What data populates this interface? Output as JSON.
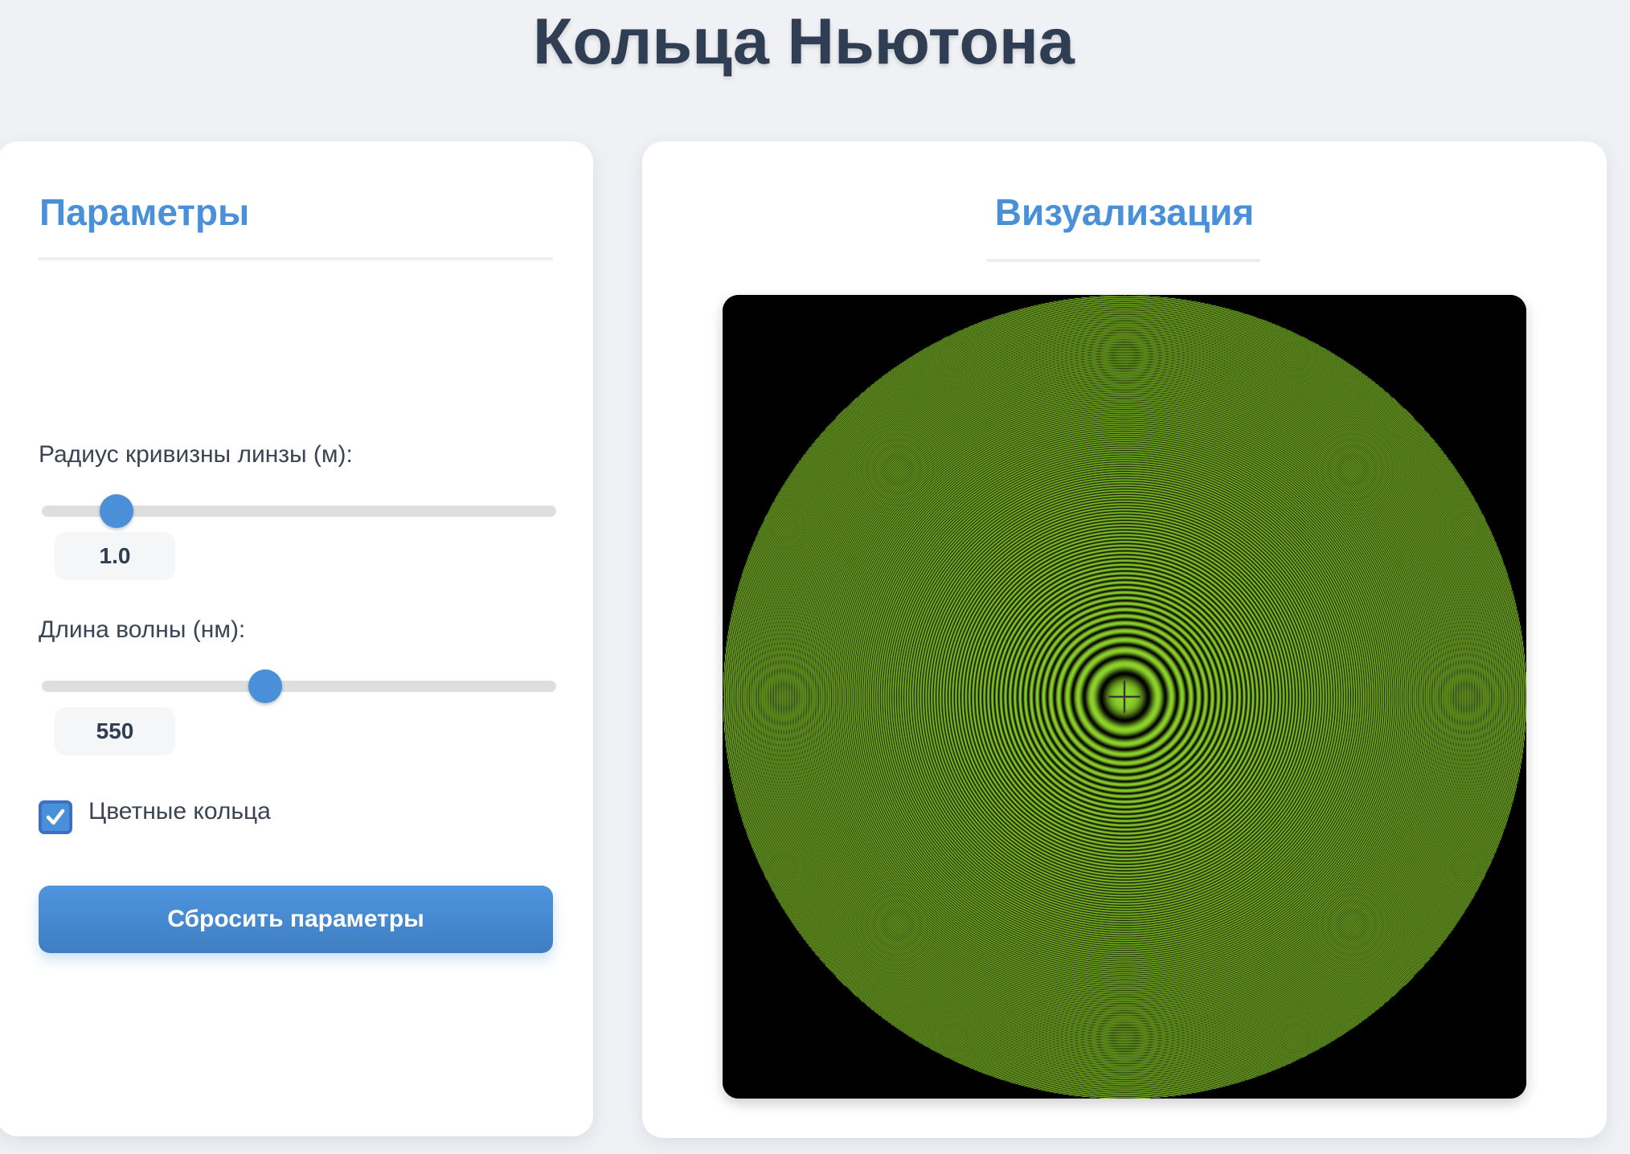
{
  "page": {
    "title": "Кольца Ньютона"
  },
  "params": {
    "title": "Параметры",
    "radius": {
      "label": "Радиус кривизны линзы (м):",
      "value": "1.0",
      "level": 0.12
    },
    "wavelength": {
      "label": "Длина волны (нм):",
      "value": "550",
      "level": 0.43
    },
    "colored_rings": {
      "label": "Цветные кольца",
      "checked": true
    },
    "reset_label": "Сбросить параметры"
  },
  "visualization": {
    "title": "Визуализация",
    "ring_color": "#8ed42b",
    "background_color": "#000000",
    "accent_color": "#4a90d9"
  }
}
